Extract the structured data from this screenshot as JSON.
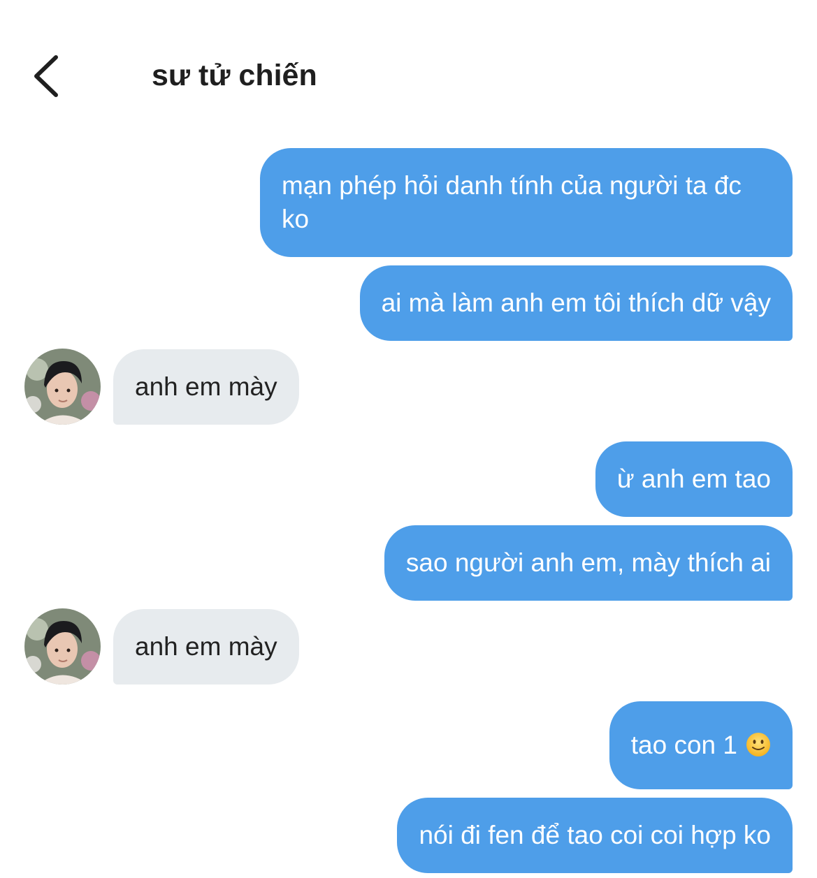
{
  "header": {
    "title": "sư tử chiến",
    "back_icon": "chevron-left-icon"
  },
  "colors": {
    "sent_bubble": "#4e9ee9",
    "received_bubble": "#e7ebee",
    "background": "#ffffff"
  },
  "messages": [
    {
      "sender": "me",
      "text": "mạn phép hỏi danh tính của người ta đc ko"
    },
    {
      "sender": "me",
      "text": "ai mà làm anh em tôi thích dữ vậy"
    },
    {
      "sender": "other",
      "text": "anh em mày"
    },
    {
      "sender": "me",
      "text": "ừ anh em tao"
    },
    {
      "sender": "me",
      "text": "sao người anh em, mày thích ai"
    },
    {
      "sender": "other",
      "text": "anh em mày"
    },
    {
      "sender": "me",
      "text": "tao con 1",
      "emoji": "slightly-smiling-face-icon"
    },
    {
      "sender": "me",
      "text": "nói đi fen để tao coi coi hợp ko"
    }
  ]
}
